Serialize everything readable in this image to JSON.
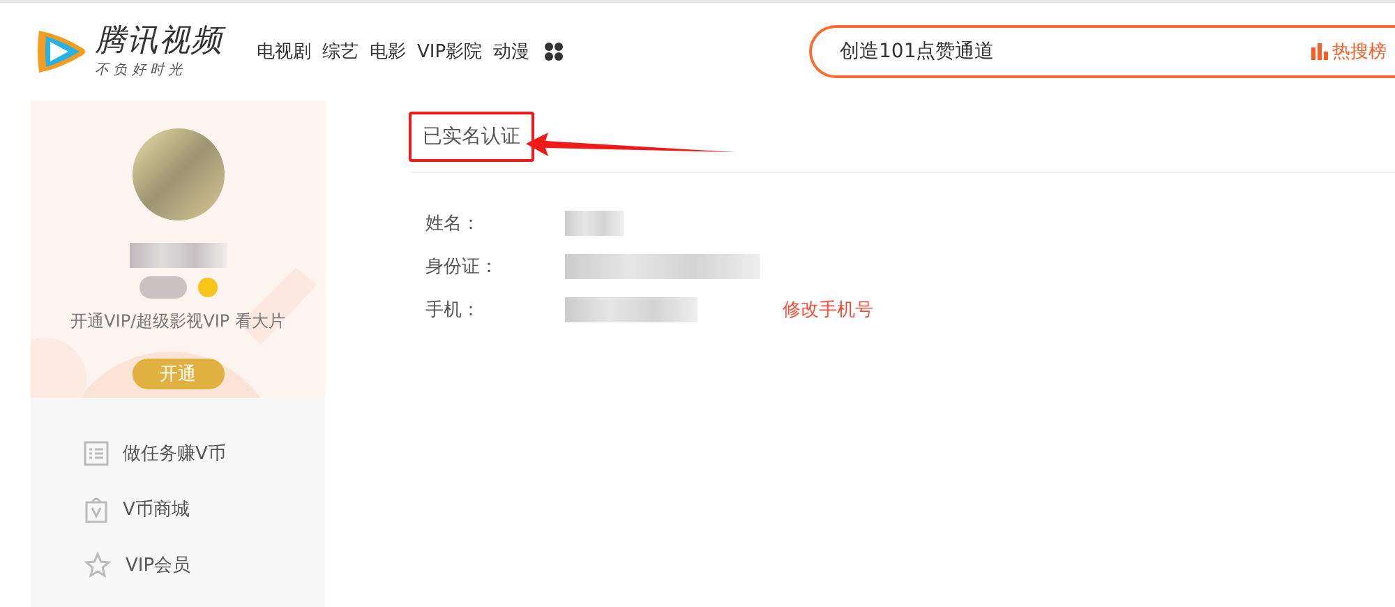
{
  "header": {
    "logo_title": "腾讯视频",
    "logo_slogan": "不 负 好 时 光",
    "nav": [
      "电视剧",
      "综艺",
      "电影",
      "VIP影院",
      "动漫"
    ],
    "search": {
      "value": "创造101点赞通道",
      "hot_label": "热搜榜"
    }
  },
  "profile": {
    "vip_prompt": "开通VIP/超级影视VIP 看大片",
    "open_button": "开通"
  },
  "sidebar": {
    "items": [
      {
        "label": "做任务赚V币",
        "kind": "tasks"
      },
      {
        "label": "V币商城",
        "kind": "shop"
      },
      {
        "label": "VIP会员",
        "kind": "vip"
      }
    ]
  },
  "verification": {
    "title": "已实名认证",
    "fields": [
      {
        "label": "姓名："
      },
      {
        "label": "身份证："
      },
      {
        "label": "手机：",
        "action": "修改手机号"
      }
    ]
  }
}
